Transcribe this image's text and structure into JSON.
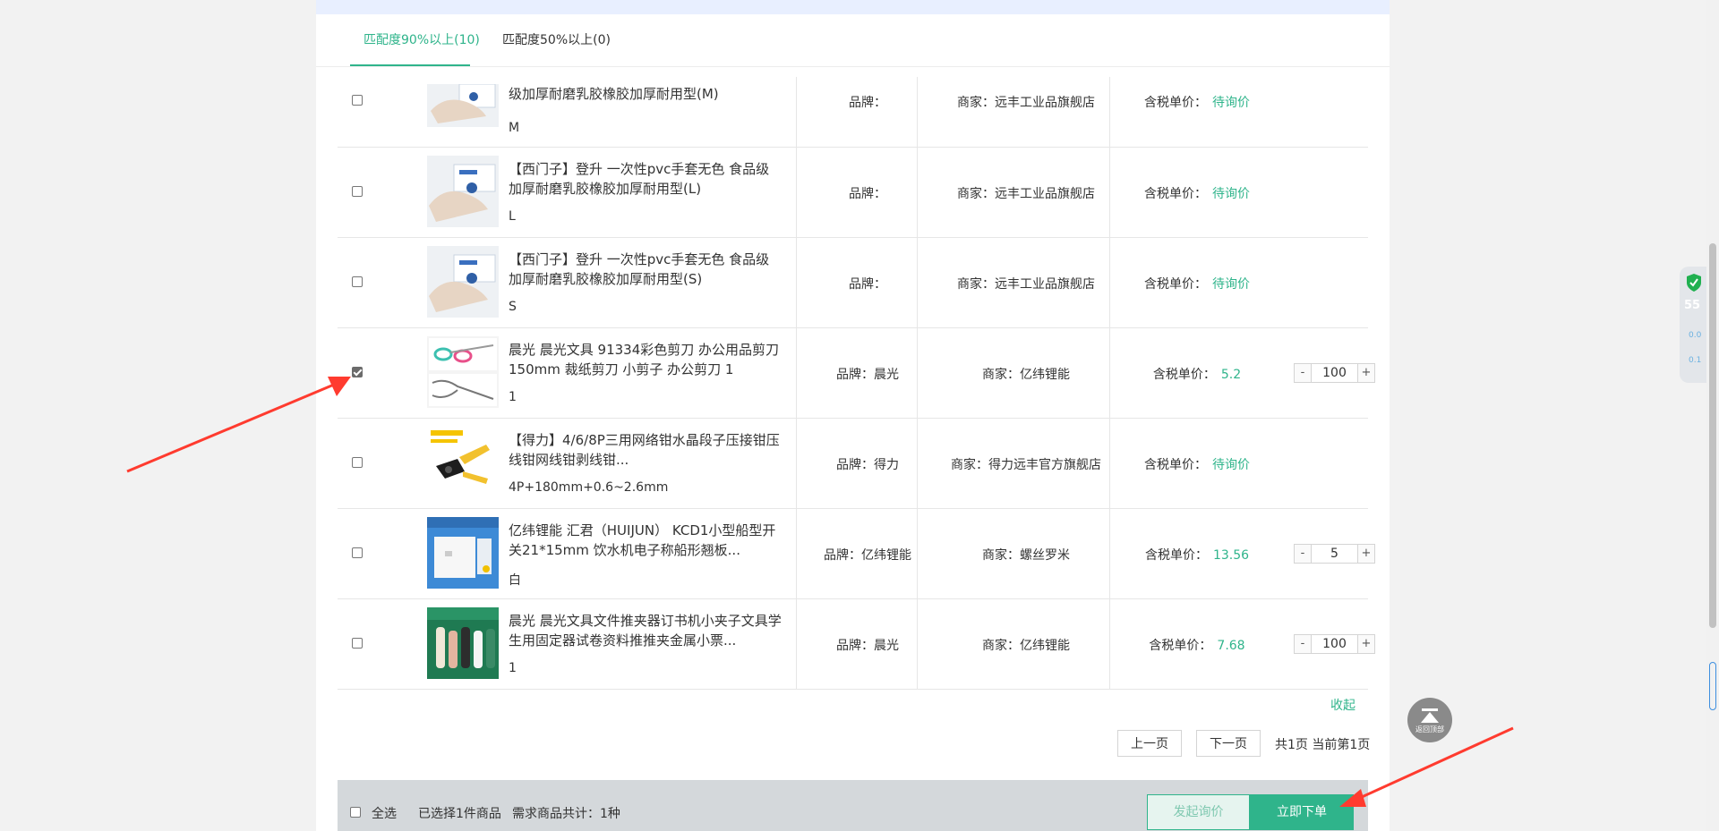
{
  "tabs": [
    {
      "label": "匹配度90%以上(10)"
    },
    {
      "label": "匹配度50%以上(0)"
    }
  ],
  "products": [
    {
      "name": "级加厚耐磨乳胶橡胶加厚耐用型(M)",
      "spec": "M",
      "brand": "品牌：",
      "merchant": "商家：远丰工业品旗舰店",
      "price_label": "含税单价：",
      "price": "待询价",
      "checked": false
    },
    {
      "name": "【西门子】登升 一次性pvc手套无色 食品级加厚耐磨乳胶橡胶加厚耐用型(L)",
      "spec": "L",
      "brand": "品牌：",
      "merchant": "商家：远丰工业品旗舰店",
      "price_label": "含税单价：",
      "price": "待询价",
      "checked": false
    },
    {
      "name": "【西门子】登升 一次性pvc手套无色 食品级加厚耐磨乳胶橡胶加厚耐用型(S)",
      "spec": "S",
      "brand": "品牌：",
      "merchant": "商家：远丰工业品旗舰店",
      "price_label": "含税单价：",
      "price": "待询价",
      "checked": false
    },
    {
      "name": "晨光 晨光文具 91334彩色剪刀 办公用品剪刀 150mm 裁纸剪刀 小剪子 办公剪刀 1",
      "spec": "1",
      "brand": "品牌：晨光",
      "merchant": "商家：亿纬锂能",
      "price_label": "含税单价：",
      "price": "5.2",
      "qty": "100",
      "checked": true
    },
    {
      "name": "【得力】4/6/8P三用网络钳水晶段子压接钳压线钳网线钳剥线钳...",
      "spec": "4P+180mm+0.6~2.6mm",
      "brand": "品牌：得力",
      "merchant": "商家：得力远丰官方旗舰店",
      "price_label": "含税单价：",
      "price": "待询价",
      "checked": false
    },
    {
      "name": "亿纬锂能 汇君（HUIJUN） KCD1小型船型开关21*15mm 饮水机电子称船形翘板...",
      "spec": "白",
      "brand": "品牌：亿纬锂能",
      "merchant": "商家：螺丝罗米",
      "price_label": "含税单价：",
      "price": "13.56",
      "qty": "5",
      "checked": false
    },
    {
      "name": "晨光 晨光文具文件推夹器订书机小夹子文具学生用固定器试卷资料推推夹金属小票...",
      "spec": "1",
      "brand": "品牌：晨光",
      "merchant": "商家：亿纬锂能",
      "price_label": "含税单价：",
      "price": "7.68",
      "qty": "100",
      "checked": false
    }
  ],
  "qty_minus": "-",
  "qty_plus": "+",
  "collapse": "收起",
  "pagination": {
    "prev": "上一页",
    "next": "下一页",
    "info": "共1页 当前第1页"
  },
  "footer": {
    "select_all": "全选",
    "selected": "已选择1件商品",
    "demand": "需求商品共计：1种",
    "inquiry_button": "发起询价",
    "order_button": "立即下单"
  },
  "scroll_top": "返回顶部",
  "widget": {
    "percent": "55",
    "up": "0.0",
    "down": "0.1"
  },
  "colors": {
    "accent": "#2fb48b",
    "arrow": "#ff3b2f"
  }
}
